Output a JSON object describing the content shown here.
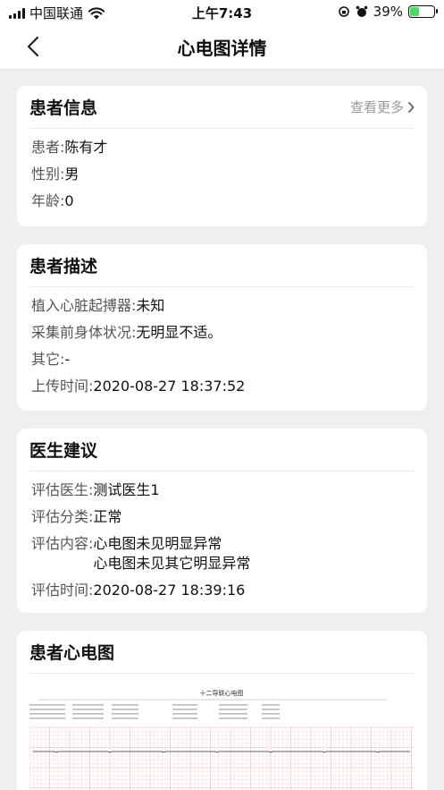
{
  "status_bar": {
    "carrier": "中国联通",
    "time": "上午7:43",
    "battery": "39%",
    "battery_level": 0.39
  },
  "nav": {
    "title": "心电图详情"
  },
  "patient_info": {
    "title": "患者信息",
    "more": "查看更多",
    "name_label": "患者: ",
    "name": "陈有才",
    "gender_label": "性别: ",
    "gender": "男",
    "age_label": "年龄: ",
    "age": "0"
  },
  "patient_desc": {
    "title": "患者描述",
    "pacemaker_label": "植入心脏起搏器: ",
    "pacemaker": "未知",
    "condition_label": "采集前身体状况: ",
    "condition": "无明显不适。",
    "other_label": "其它: ",
    "other": "-",
    "upload_label": "上传时间: ",
    "upload_time": "2020-08-27 18:37:52"
  },
  "doctor_advice": {
    "title": "医生建议",
    "doctor_label": "评估医生: ",
    "doctor": "测试医生1",
    "category_label": "评估分类: ",
    "category": "正常",
    "content_label": "评估内容: ",
    "content_line1": "心电图未见明显异常",
    "content_line2": "心电图未见其它明显异常",
    "eval_time_label": "评估时间: ",
    "eval_time": "2020-08-27 18:39:16"
  },
  "ecg": {
    "title": "患者心电图",
    "report_title": "十二导联心电图"
  },
  "colors": {
    "background": "#efefef",
    "card": "#ffffff",
    "ecg_grid": "#f3b8b8"
  }
}
